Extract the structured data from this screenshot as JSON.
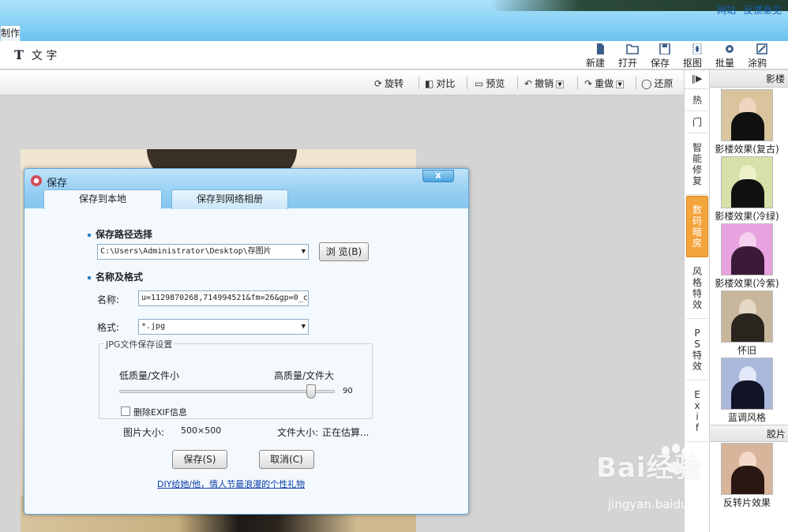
{
  "header": {
    "links": [
      "网站",
      "反馈意见"
    ],
    "partial_tab": "制作"
  },
  "toolbar": {
    "text_tool": {
      "icon": "text-T-icon",
      "label": "文 字"
    },
    "buttons": [
      {
        "id": "new",
        "label": "新建",
        "icon": "new-file-icon"
      },
      {
        "id": "open",
        "label": "打开",
        "icon": "folder-icon"
      },
      {
        "id": "save",
        "label": "保存",
        "icon": "floppy-icon"
      },
      {
        "id": "cutout",
        "label": "抠图",
        "icon": "cutout-icon"
      },
      {
        "id": "batch",
        "label": "批量",
        "icon": "gear-icon"
      },
      {
        "id": "doodle",
        "label": "涂鸦",
        "icon": "brush-icon"
      }
    ]
  },
  "toolbar2": {
    "rotate": "旋转",
    "compare": "对比",
    "preview": "预览",
    "undo": "撤销",
    "redo": "重做",
    "restore": "还原"
  },
  "side_tabs": [
    "热",
    "门",
    "智能修复",
    "数码暗房",
    "风格特效",
    "PS特效",
    "Exif"
  ],
  "side_tabs_active": "数码暗房",
  "effects_panel": {
    "header": "影楼",
    "items": [
      {
        "caption": "影楼效果(复古)",
        "tint": "#d9c49e"
      },
      {
        "caption": "影楼效果(冷绿)",
        "tint": "#d6e0a8"
      },
      {
        "caption": "影楼效果(冷紫)",
        "tint": "#e7a2df"
      },
      {
        "caption": "怀旧",
        "tint": "#c9b79d"
      },
      {
        "caption": "蓝调风格",
        "tint": "#aab8dc"
      }
    ],
    "header2": "胶片",
    "items2": [
      {
        "caption": "反转片效果",
        "tint": "#d8b49a"
      }
    ]
  },
  "dialog": {
    "title": "保存",
    "close": "x",
    "tabs": [
      "保存到本地",
      "保存到网络相册"
    ],
    "path_section": "保存路径选择",
    "path_value": "C:\\Users\\Administrator\\Desktop\\存图片",
    "browse": "浏 览(B)",
    "name_section": "名称及格式",
    "name_label": "名称:",
    "name_value": "u=1129870268,714994521&fm=26&gp=0_c",
    "format_label": "格式:",
    "format_value": "*.jpg",
    "jpg_group": "JPG文件保存设置",
    "low_quality": "低质量/文件小",
    "high_quality": "高质量/文件大",
    "quality": 90,
    "quality_text": "90",
    "strip_exif": "删除EXIF信息",
    "image_size_label": "图片大小:",
    "image_size": "500×500",
    "file_size_label": "文件大小:",
    "file_size": "正在估算...",
    "save_btn": "保存(S)",
    "cancel_btn": "取消(C)",
    "promo_link": "DIY给她/他，情人节最浪漫的个性礼物"
  },
  "watermark": {
    "brand": "Bai经验",
    "url": "jingyan.baidu.com"
  }
}
